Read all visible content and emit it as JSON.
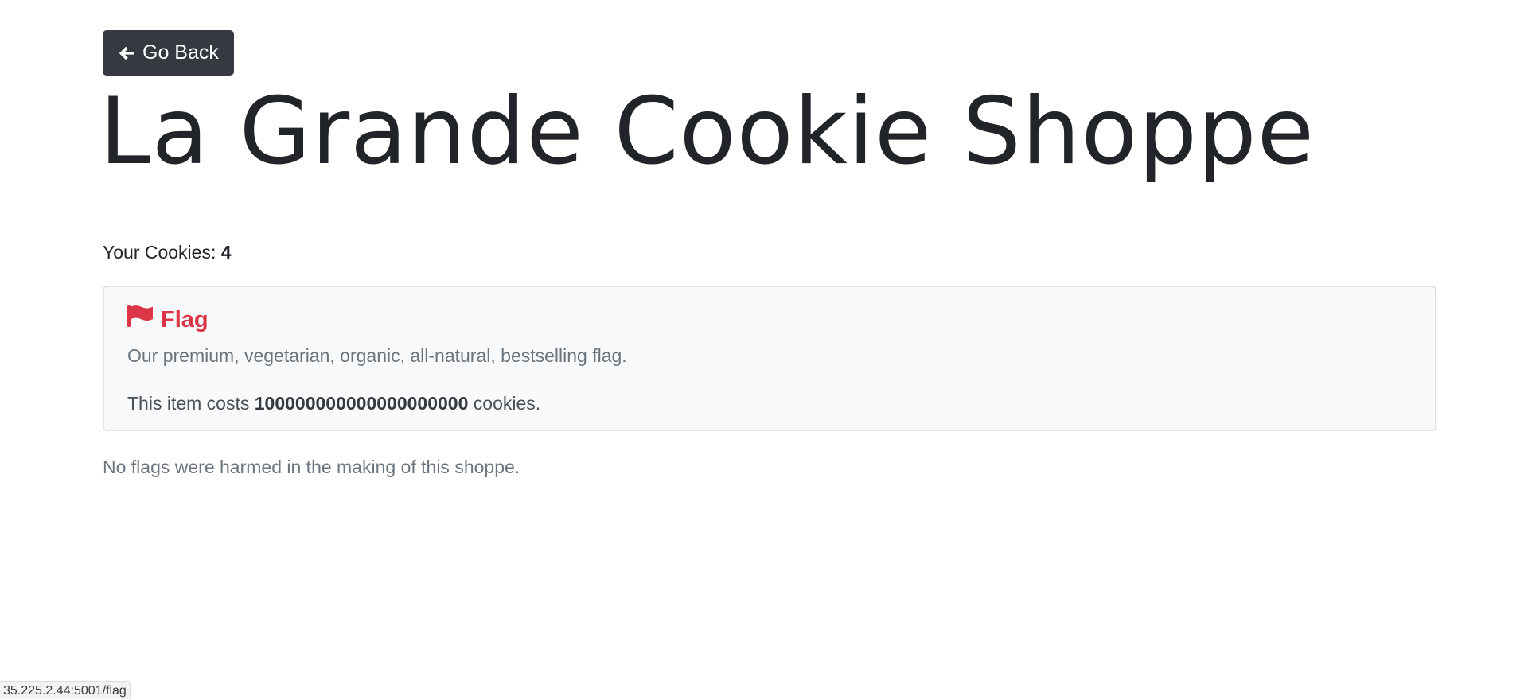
{
  "nav": {
    "back_label": "Go Back",
    "back_icon": "arrow-left-icon"
  },
  "page": {
    "title": "La Grande Cookie Shoppe"
  },
  "cookies": {
    "label": "Your Cookies: ",
    "count": "4"
  },
  "item": {
    "icon": "flag-icon",
    "name": "Flag",
    "description": "Our premium, vegetarian, organic, all-natural, bestselling flag.",
    "cost_prefix": "This item costs ",
    "cost": "100000000000000000000",
    "cost_suffix": " cookies.",
    "accent_color": "#dc3545"
  },
  "footer": {
    "note": "No flags were harmed in the making of this shoppe."
  },
  "status_bar": {
    "url": "35.225.2.44:5001/flag"
  }
}
